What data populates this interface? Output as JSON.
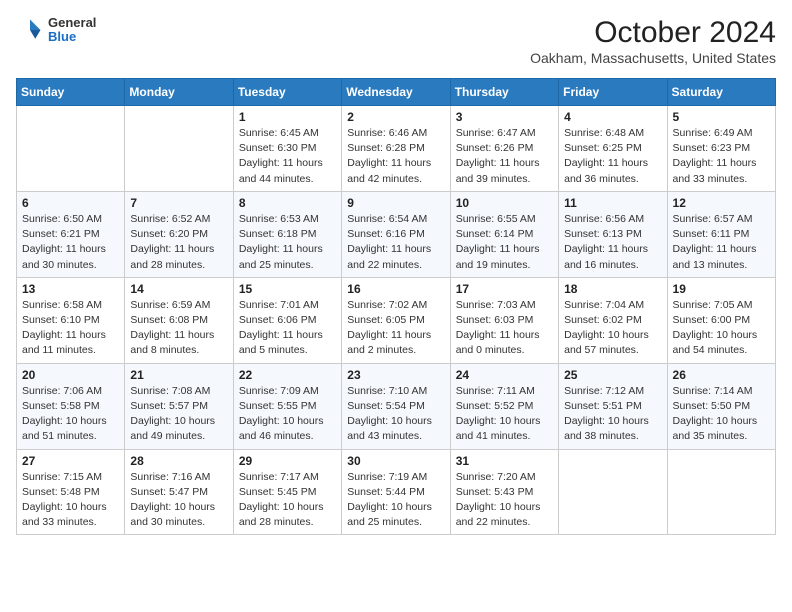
{
  "header": {
    "logo": {
      "general": "General",
      "blue": "Blue"
    },
    "title": "October 2024",
    "subtitle": "Oakham, Massachusetts, United States"
  },
  "days_of_week": [
    "Sunday",
    "Monday",
    "Tuesday",
    "Wednesday",
    "Thursday",
    "Friday",
    "Saturday"
  ],
  "weeks": [
    [
      {
        "day": "",
        "detail": ""
      },
      {
        "day": "",
        "detail": ""
      },
      {
        "day": "1",
        "detail": "Sunrise: 6:45 AM\nSunset: 6:30 PM\nDaylight: 11 hours and 44 minutes."
      },
      {
        "day": "2",
        "detail": "Sunrise: 6:46 AM\nSunset: 6:28 PM\nDaylight: 11 hours and 42 minutes."
      },
      {
        "day": "3",
        "detail": "Sunrise: 6:47 AM\nSunset: 6:26 PM\nDaylight: 11 hours and 39 minutes."
      },
      {
        "day": "4",
        "detail": "Sunrise: 6:48 AM\nSunset: 6:25 PM\nDaylight: 11 hours and 36 minutes."
      },
      {
        "day": "5",
        "detail": "Sunrise: 6:49 AM\nSunset: 6:23 PM\nDaylight: 11 hours and 33 minutes."
      }
    ],
    [
      {
        "day": "6",
        "detail": "Sunrise: 6:50 AM\nSunset: 6:21 PM\nDaylight: 11 hours and 30 minutes."
      },
      {
        "day": "7",
        "detail": "Sunrise: 6:52 AM\nSunset: 6:20 PM\nDaylight: 11 hours and 28 minutes."
      },
      {
        "day": "8",
        "detail": "Sunrise: 6:53 AM\nSunset: 6:18 PM\nDaylight: 11 hours and 25 minutes."
      },
      {
        "day": "9",
        "detail": "Sunrise: 6:54 AM\nSunset: 6:16 PM\nDaylight: 11 hours and 22 minutes."
      },
      {
        "day": "10",
        "detail": "Sunrise: 6:55 AM\nSunset: 6:14 PM\nDaylight: 11 hours and 19 minutes."
      },
      {
        "day": "11",
        "detail": "Sunrise: 6:56 AM\nSunset: 6:13 PM\nDaylight: 11 hours and 16 minutes."
      },
      {
        "day": "12",
        "detail": "Sunrise: 6:57 AM\nSunset: 6:11 PM\nDaylight: 11 hours and 13 minutes."
      }
    ],
    [
      {
        "day": "13",
        "detail": "Sunrise: 6:58 AM\nSunset: 6:10 PM\nDaylight: 11 hours and 11 minutes."
      },
      {
        "day": "14",
        "detail": "Sunrise: 6:59 AM\nSunset: 6:08 PM\nDaylight: 11 hours and 8 minutes."
      },
      {
        "day": "15",
        "detail": "Sunrise: 7:01 AM\nSunset: 6:06 PM\nDaylight: 11 hours and 5 minutes."
      },
      {
        "day": "16",
        "detail": "Sunrise: 7:02 AM\nSunset: 6:05 PM\nDaylight: 11 hours and 2 minutes."
      },
      {
        "day": "17",
        "detail": "Sunrise: 7:03 AM\nSunset: 6:03 PM\nDaylight: 11 hours and 0 minutes."
      },
      {
        "day": "18",
        "detail": "Sunrise: 7:04 AM\nSunset: 6:02 PM\nDaylight: 10 hours and 57 minutes."
      },
      {
        "day": "19",
        "detail": "Sunrise: 7:05 AM\nSunset: 6:00 PM\nDaylight: 10 hours and 54 minutes."
      }
    ],
    [
      {
        "day": "20",
        "detail": "Sunrise: 7:06 AM\nSunset: 5:58 PM\nDaylight: 10 hours and 51 minutes."
      },
      {
        "day": "21",
        "detail": "Sunrise: 7:08 AM\nSunset: 5:57 PM\nDaylight: 10 hours and 49 minutes."
      },
      {
        "day": "22",
        "detail": "Sunrise: 7:09 AM\nSunset: 5:55 PM\nDaylight: 10 hours and 46 minutes."
      },
      {
        "day": "23",
        "detail": "Sunrise: 7:10 AM\nSunset: 5:54 PM\nDaylight: 10 hours and 43 minutes."
      },
      {
        "day": "24",
        "detail": "Sunrise: 7:11 AM\nSunset: 5:52 PM\nDaylight: 10 hours and 41 minutes."
      },
      {
        "day": "25",
        "detail": "Sunrise: 7:12 AM\nSunset: 5:51 PM\nDaylight: 10 hours and 38 minutes."
      },
      {
        "day": "26",
        "detail": "Sunrise: 7:14 AM\nSunset: 5:50 PM\nDaylight: 10 hours and 35 minutes."
      }
    ],
    [
      {
        "day": "27",
        "detail": "Sunrise: 7:15 AM\nSunset: 5:48 PM\nDaylight: 10 hours and 33 minutes."
      },
      {
        "day": "28",
        "detail": "Sunrise: 7:16 AM\nSunset: 5:47 PM\nDaylight: 10 hours and 30 minutes."
      },
      {
        "day": "29",
        "detail": "Sunrise: 7:17 AM\nSunset: 5:45 PM\nDaylight: 10 hours and 28 minutes."
      },
      {
        "day": "30",
        "detail": "Sunrise: 7:19 AM\nSunset: 5:44 PM\nDaylight: 10 hours and 25 minutes."
      },
      {
        "day": "31",
        "detail": "Sunrise: 7:20 AM\nSunset: 5:43 PM\nDaylight: 10 hours and 22 minutes."
      },
      {
        "day": "",
        "detail": ""
      },
      {
        "day": "",
        "detail": ""
      }
    ]
  ]
}
